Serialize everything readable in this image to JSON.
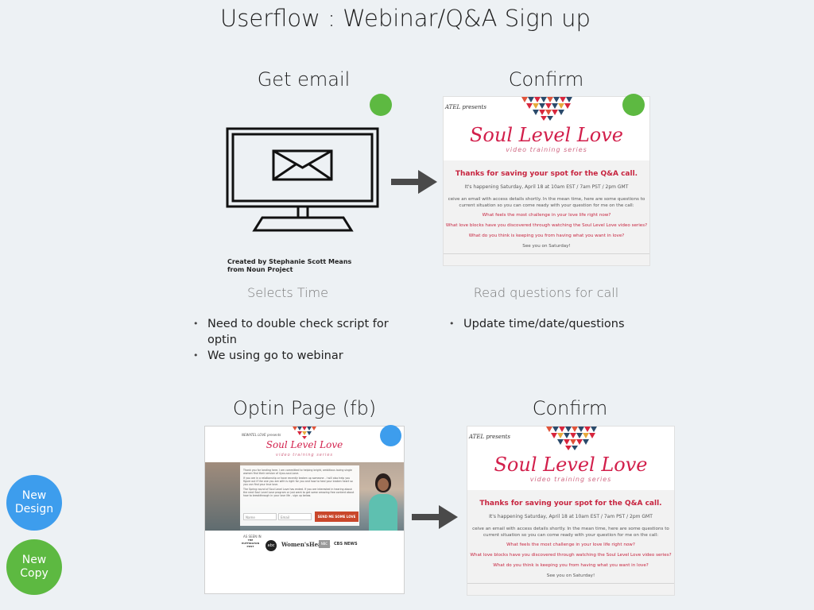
{
  "title": "Userflow : Webinar/Q&A Sign up",
  "flow1": {
    "step1": {
      "heading": "Get email",
      "credit_line1": "Created by Stephanie Scott Means",
      "credit_line2": "from Noun Project",
      "subheading": "Selects Time",
      "notes": [
        "Need to double check script for optin",
        "We using go to webinar"
      ]
    },
    "step2": {
      "heading": "Confirm",
      "subheading": "Read questions for call",
      "notes": [
        "Update time/date/questions"
      ]
    }
  },
  "flow2": {
    "step1": {
      "heading": "Optin Page (fb)"
    },
    "step2": {
      "heading": "Confirm"
    }
  },
  "confirm_email": {
    "presents": "ATEL presents",
    "brand": "Soul Level Love",
    "tagline": "video training series",
    "thanks": "Thanks for saving your spot for the Q&A call.",
    "when": "It's happening Saturday, April 18 at  10am EST / 7am PST / 2pm GMT",
    "intro_line1": "ceive an email with access details shortly. In the mean time, here are some questions to",
    "intro_line2": "current situation so you can come ready with your question for me on the call:",
    "q1": "What feels the most challenge in your love life right now?",
    "q2": "What love blocks have you discovered through watching the Soul Level Love video series?",
    "q3": "What do you think is keeping you from having what you want in love?",
    "closing": "See you on Saturday!"
  },
  "optin_page": {
    "presents": "NEWATEL LOVE presents",
    "brand": "Soul Level Love",
    "tagline": "video training series",
    "para1": "Thank you for landing here. I am committed to helping bright, ambitious loving single women find their version of 4you-soul-Love.",
    "para2": "If you are in a relationship or have recently broken up someone - I will also help you figure out if the one you are with is right for you and how to heal your broken heart so you can find your true love.",
    "para3": "The Spring round of Soul Level Love has ended. If you are interested in hearing about the next Soul Level Love program or just want to get some amazing free content about how to breakthrough in your love life - sign up below.",
    "field_name": "Name",
    "field_email": "Email",
    "cta": "SEND ME SOME LOVE",
    "as_seen_in": "AS SEEN IN",
    "logos": [
      "THE HUFFINGTON POST",
      "abc",
      "Women'sHealth",
      "NBC",
      "CBS NEWS"
    ]
  },
  "side_buttons": {
    "design_line1": "New",
    "design_line2": "Design",
    "copy_line1": "New",
    "copy_line2": "Copy"
  },
  "colors": {
    "background": "#edf1f4",
    "status_green": "#5db941",
    "status_blue": "#3d9ded",
    "brand_red": "#d21f4b",
    "arrow": "#4a4a4a",
    "cta_orange": "#c9472b"
  },
  "icons": [
    "monitor-email-icon",
    "arrow-right-icon",
    "mandala-logo-icon"
  ]
}
